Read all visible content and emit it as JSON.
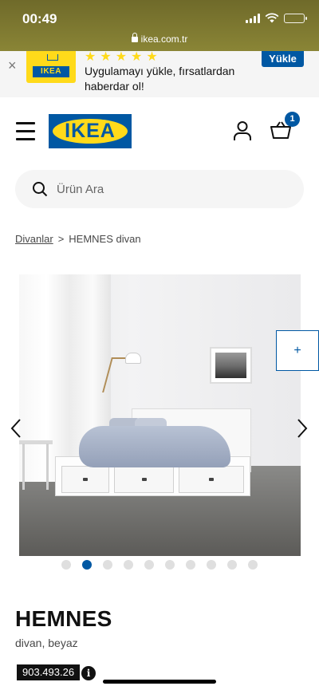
{
  "status_bar": {
    "time": "00:49",
    "url": "ikea.com.tr"
  },
  "app_banner": {
    "close_label": "×",
    "logo_text": "IKEA",
    "stars": "★★★★★",
    "message": "Uygulamayı yükle, fırsatlardan haberdar ol!",
    "install_label": "Yükle"
  },
  "header": {
    "logo_text": "IKEA",
    "cart_count": "1"
  },
  "search": {
    "placeholder": "Ürün Ara"
  },
  "breadcrumb": {
    "parent": "Divanlar",
    "separator": ">",
    "current": "HEMNES divan"
  },
  "gallery": {
    "plus_label": "+",
    "slide_count": 10,
    "active_slide": 2
  },
  "product": {
    "name": "HEMNES",
    "description": "divan, beyaz",
    "article_number": "903.493.26",
    "info_label": "i"
  },
  "colors": {
    "ikea_blue": "#0058a3",
    "ikea_yellow": "#ffda1a",
    "status_bg": "#767030"
  }
}
